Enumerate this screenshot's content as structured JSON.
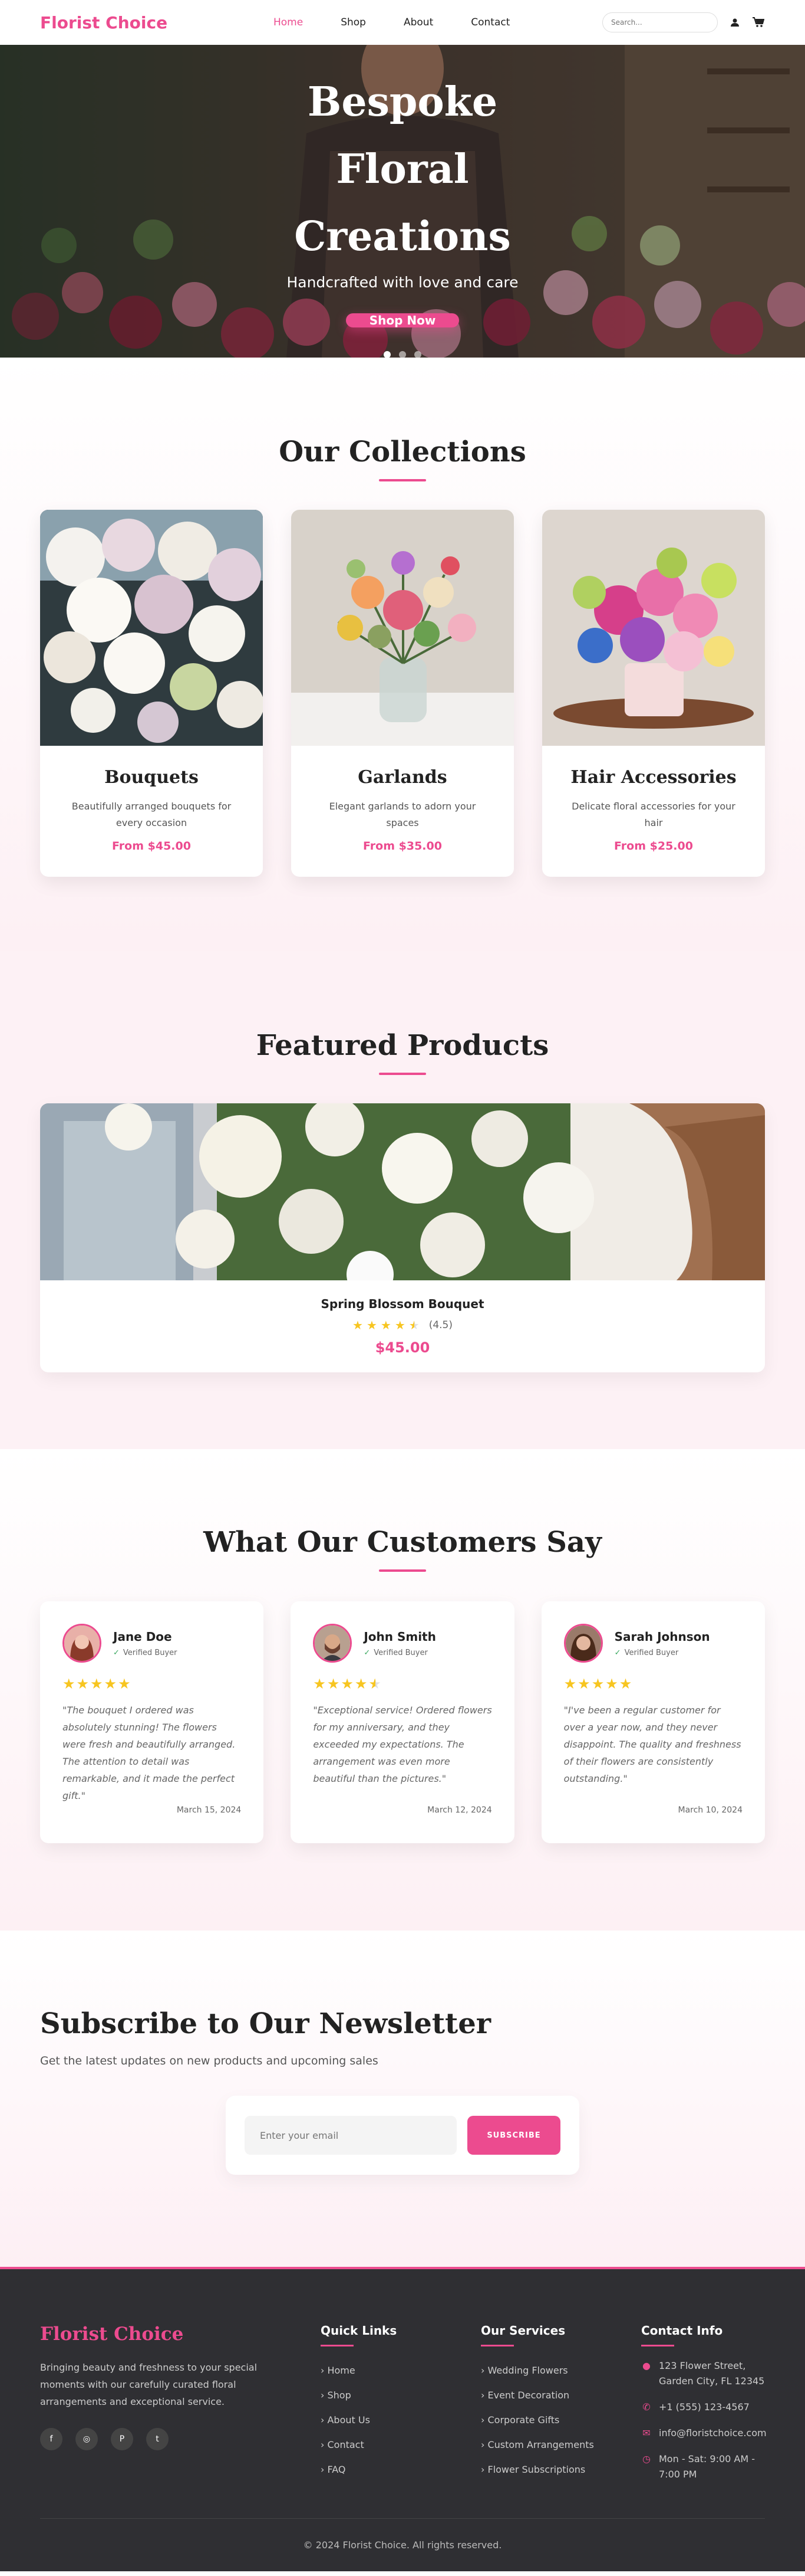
{
  "header": {
    "logo": "Florist Choice",
    "nav": [
      {
        "label": "Home",
        "active": true
      },
      {
        "label": "Shop",
        "active": false
      },
      {
        "label": "About",
        "active": false
      },
      {
        "label": "Contact",
        "active": false
      }
    ],
    "search_placeholder": "Search...",
    "icons": [
      "user-icon",
      "cart-icon"
    ]
  },
  "hero": {
    "title": "Bespoke Floral Creations",
    "subtitle": "Handcrafted with love and care",
    "cta": "Shop Now",
    "slides": 3,
    "active_slide": 1
  },
  "collections": {
    "title": "Our Collections",
    "items": [
      {
        "name": "Bouquets",
        "desc": "Beautifully arranged bouquets for every occasion",
        "price": "From $45.00"
      },
      {
        "name": "Garlands",
        "desc": "Elegant garlands to adorn your spaces",
        "price": "From $35.00"
      },
      {
        "name": "Hair Accessories",
        "desc": "Delicate floral accessories for your hair",
        "price": "From $25.00"
      }
    ]
  },
  "featured": {
    "title": "Featured Products",
    "product": {
      "name": "Spring Blossom Bouquet",
      "rating": 4.5,
      "rating_text": "(4.5)",
      "price": "$45.00"
    }
  },
  "testimonials": {
    "title": "What Our Customers Say",
    "verified_label": "Verified Buyer",
    "items": [
      {
        "name": "Jane Doe",
        "rating": 5,
        "quote": "\"The bouquet I ordered was absolutely stunning! The flowers were fresh and beautifully arranged. The attention to detail was remarkable, and it made the perfect gift.\"",
        "date": "March 15, 2024"
      },
      {
        "name": "John Smith",
        "rating": 4.5,
        "quote": "\"Exceptional service! Ordered flowers for my anniversary, and they exceeded my expectations. The arrangement was even more beautiful than the pictures.\"",
        "date": "March 12, 2024"
      },
      {
        "name": "Sarah Johnson",
        "rating": 5,
        "quote": "\"I've been a regular customer for over a year now, and they never disappoint. The quality and freshness of their flowers are consistently outstanding.\"",
        "date": "March 10, 2024"
      }
    ]
  },
  "newsletter": {
    "title": "Subscribe to Our Newsletter",
    "subtitle": "Get the latest updates on new products and upcoming sales",
    "placeholder": "Enter your email",
    "button": "SUBSCRIBE"
  },
  "footer": {
    "logo": "Florist Choice",
    "desc": "Bringing beauty and freshness to your special moments with our carefully curated floral arrangements and exceptional service.",
    "socials": [
      "facebook-icon",
      "instagram-icon",
      "pinterest-icon",
      "twitter-icon"
    ],
    "quick_links_title": "Quick Links",
    "quick_links": [
      "Home",
      "Shop",
      "About Us",
      "Contact",
      "FAQ"
    ],
    "services_title": "Our Services",
    "services": [
      "Wedding Flowers",
      "Event Decoration",
      "Corporate Gifts",
      "Custom Arrangements",
      "Flower Subscriptions"
    ],
    "contact_title": "Contact Info",
    "contact": {
      "address": "123 Flower Street, Garden City, FL 12345",
      "phone": "+1 (555) 123-4567",
      "email": "info@floristchoice.com",
      "hours": "Mon - Sat: 9:00 AM - 7:00 PM"
    },
    "copyright": "© 2024 Florist Choice. All rights reserved."
  },
  "colors": {
    "accent": "#ec4b8f",
    "footer_bg": "#2f2f33",
    "star": "#f7c520"
  }
}
